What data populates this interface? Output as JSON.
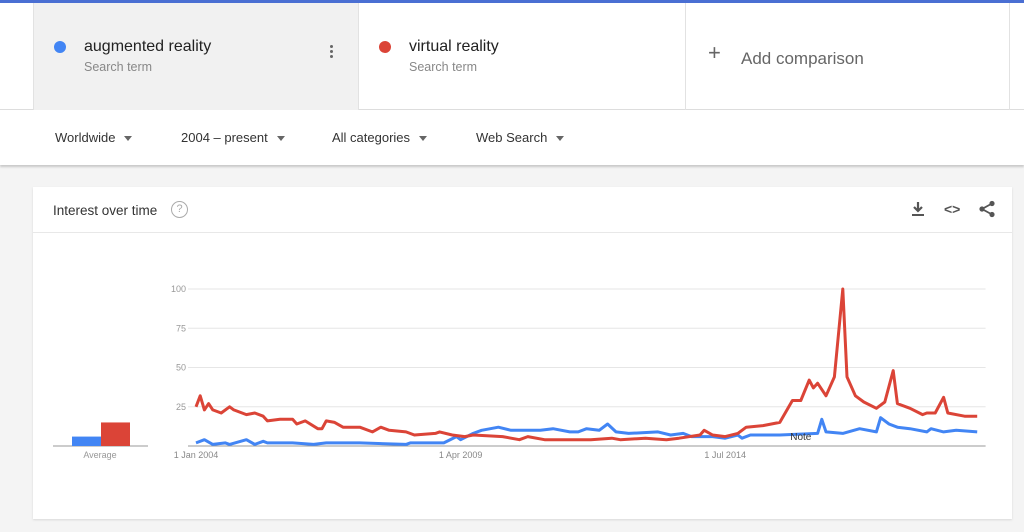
{
  "terms": [
    {
      "name": "augmented reality",
      "sub": "Search term",
      "color": "#4285f4"
    },
    {
      "name": "virtual reality",
      "sub": "Search term",
      "color": "#db4437"
    }
  ],
  "add_comparison": "Add comparison",
  "filters": {
    "region": "Worldwide",
    "time": "2004 – present",
    "category": "All categories",
    "search_type": "Web Search"
  },
  "card": {
    "title": "Interest over time",
    "help": "?",
    "icons": [
      "download-icon",
      "embed-code-icon",
      "share-icon"
    ]
  },
  "chart_data": {
    "type": "line",
    "title": "",
    "ylim": [
      0,
      100
    ],
    "y_ticks": [
      "100",
      "75",
      "50",
      "25"
    ],
    "x_tick_labels": [
      "1 Jan 2004",
      "1 Apr 2009",
      "1 Jul 2014"
    ],
    "x_ticks": [
      "2004-01",
      "2009-04",
      "2014-07"
    ],
    "xlim": [
      "2004-01",
      "2019-09"
    ],
    "grid": true,
    "annotation": "Note",
    "annotation_date": "2016-01",
    "average": {
      "label": "Average",
      "values": [
        6,
        15
      ]
    },
    "series": [
      {
        "name": "augmented reality",
        "color": "#4285f4",
        "points": [
          [
            "2004-01",
            2
          ],
          [
            "2004-03",
            4
          ],
          [
            "2004-05",
            1
          ],
          [
            "2004-08",
            2
          ],
          [
            "2004-09",
            1
          ],
          [
            "2005-01",
            4
          ],
          [
            "2005-03",
            1
          ],
          [
            "2005-05",
            3
          ],
          [
            "2005-06",
            2
          ],
          [
            "2005-12",
            2
          ],
          [
            "2006-05",
            1
          ],
          [
            "2006-08",
            2
          ],
          [
            "2007-04",
            2
          ],
          [
            "2008-03",
            1
          ],
          [
            "2008-04",
            2
          ],
          [
            "2008-12",
            2
          ],
          [
            "2009-03",
            6
          ],
          [
            "2009-04",
            4
          ],
          [
            "2009-07",
            8
          ],
          [
            "2009-09",
            10
          ],
          [
            "2010-01",
            12
          ],
          [
            "2010-04",
            10
          ],
          [
            "2010-11",
            10
          ],
          [
            "2011-02",
            11
          ],
          [
            "2011-06",
            9
          ],
          [
            "2011-08",
            9
          ],
          [
            "2011-10",
            11
          ],
          [
            "2012-01",
            10
          ],
          [
            "2012-03",
            14
          ],
          [
            "2012-05",
            9
          ],
          [
            "2012-08",
            8
          ],
          [
            "2013-03",
            9
          ],
          [
            "2013-06",
            7
          ],
          [
            "2013-09",
            8
          ],
          [
            "2013-11",
            6
          ],
          [
            "2014-04",
            6
          ],
          [
            "2014-07",
            5
          ],
          [
            "2014-10",
            7
          ],
          [
            "2014-11",
            5
          ],
          [
            "2015-01",
            7
          ],
          [
            "2015-08",
            7
          ],
          [
            "2016-05",
            8
          ],
          [
            "2016-06",
            17
          ],
          [
            "2016-07",
            9
          ],
          [
            "2016-11",
            8
          ],
          [
            "2017-03",
            11
          ],
          [
            "2017-07",
            9
          ],
          [
            "2017-08",
            18
          ],
          [
            "2017-10",
            14
          ],
          [
            "2017-12",
            12
          ],
          [
            "2018-03",
            11
          ],
          [
            "2018-07",
            9
          ],
          [
            "2018-08",
            11
          ],
          [
            "2018-11",
            9
          ],
          [
            "2019-02",
            10
          ],
          [
            "2019-07",
            9
          ]
        ]
      },
      {
        "name": "virtual reality",
        "color": "#db4437",
        "points": [
          [
            "2004-01",
            25
          ],
          [
            "2004-02",
            32
          ],
          [
            "2004-03",
            23
          ],
          [
            "2004-04",
            27
          ],
          [
            "2004-05",
            23
          ],
          [
            "2004-07",
            21
          ],
          [
            "2004-09",
            25
          ],
          [
            "2004-10",
            23
          ],
          [
            "2005-01",
            20
          ],
          [
            "2005-03",
            21
          ],
          [
            "2005-05",
            19
          ],
          [
            "2005-06",
            16
          ],
          [
            "2005-09",
            17
          ],
          [
            "2005-12",
            17
          ],
          [
            "2006-01",
            14
          ],
          [
            "2006-03",
            16
          ],
          [
            "2006-06",
            11
          ],
          [
            "2006-07",
            11
          ],
          [
            "2006-08",
            16
          ],
          [
            "2006-10",
            15
          ],
          [
            "2006-12",
            12
          ],
          [
            "2007-04",
            12
          ],
          [
            "2007-07",
            9
          ],
          [
            "2007-09",
            12
          ],
          [
            "2007-11",
            10
          ],
          [
            "2008-03",
            9
          ],
          [
            "2008-05",
            7
          ],
          [
            "2008-10",
            8
          ],
          [
            "2008-11",
            9
          ],
          [
            "2009-02",
            7
          ],
          [
            "2009-05",
            6
          ],
          [
            "2009-07",
            7
          ],
          [
            "2010-02",
            6
          ],
          [
            "2010-06",
            4
          ],
          [
            "2010-08",
            6
          ],
          [
            "2010-12",
            4
          ],
          [
            "2011-07",
            4
          ],
          [
            "2011-11",
            4
          ],
          [
            "2012-04",
            5
          ],
          [
            "2012-06",
            4
          ],
          [
            "2012-12",
            5
          ],
          [
            "2013-05",
            4
          ],
          [
            "2013-08",
            5
          ],
          [
            "2014-01",
            7
          ],
          [
            "2014-02",
            10
          ],
          [
            "2014-04",
            7
          ],
          [
            "2014-07",
            6
          ],
          [
            "2014-10",
            8
          ],
          [
            "2014-12",
            12
          ],
          [
            "2015-04",
            13
          ],
          [
            "2015-08",
            15
          ],
          [
            "2015-11",
            29
          ],
          [
            "2016-01",
            29
          ],
          [
            "2016-03",
            42
          ],
          [
            "2016-04",
            37
          ],
          [
            "2016-05",
            40
          ],
          [
            "2016-07",
            32
          ],
          [
            "2016-09",
            44
          ],
          [
            "2016-11",
            100
          ],
          [
            "2016-12",
            44
          ],
          [
            "2017-02",
            32
          ],
          [
            "2017-04",
            28
          ],
          [
            "2017-07",
            24
          ],
          [
            "2017-09",
            28
          ],
          [
            "2017-11",
            48
          ],
          [
            "2017-12",
            27
          ],
          [
            "2018-03",
            24
          ],
          [
            "2018-06",
            20
          ],
          [
            "2018-07",
            21
          ],
          [
            "2018-09",
            21
          ],
          [
            "2018-11",
            31
          ],
          [
            "2018-12",
            21
          ],
          [
            "2019-04",
            19
          ],
          [
            "2019-07",
            19
          ]
        ]
      }
    ]
  }
}
